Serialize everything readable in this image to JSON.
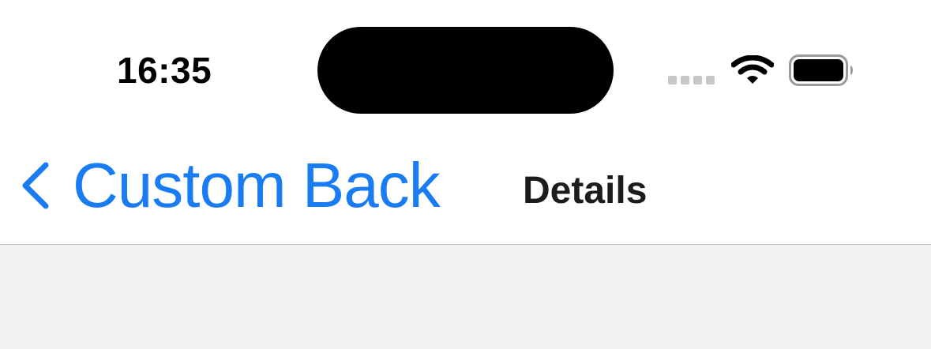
{
  "status_bar": {
    "time": "16:35",
    "icons": [
      "cellular-signal-icon",
      "wifi-icon",
      "battery-icon"
    ]
  },
  "nav": {
    "back_label": "Custom Back",
    "title": "Details",
    "accent_color": "#1a7cf2"
  }
}
